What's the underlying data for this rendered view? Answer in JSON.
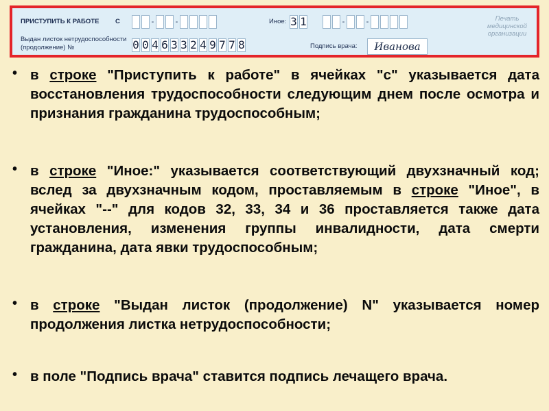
{
  "form": {
    "start_work_label": "ПРИСТУПИТЬ К РАБОТЕ",
    "from_label": "С",
    "other_label": "Иное:",
    "other_code": [
      "3",
      "1"
    ],
    "issued_label_line1": "Выдан листок нетрудоспособности",
    "issued_label_line2": "(продолжение) №",
    "issued_number": [
      "0",
      "0",
      "4",
      "6",
      "3",
      "3",
      "2",
      "4",
      "9",
      "7",
      "7",
      "8"
    ],
    "doctor_signature_label": "Подпись врача:",
    "doctor_signature_value": "Иванова",
    "stamp_line1": "Печать",
    "stamp_line2": "медицинской",
    "stamp_line3": "организации",
    "date_separator": "-"
  },
  "bullets": [
    {
      "marker": "•",
      "p1": "в ",
      "link": "строке",
      "p2": " \"Приступить к работе\" в ячейках \"с\" указывается дата восстановления трудоспособности следующим днем после осмотра и признания гражданина трудоспособным;"
    },
    {
      "marker": "•",
      "p1": "в ",
      "link": "строке",
      "p2": " \"Иное:\" указывается соответствующий двухзначный код; вслед за двухзначным кодом, проставляемым в ",
      "link2": "строке",
      "p3": " \"Иное\", в ячейках \"--\" для кодов 32, 33, 34 и 36 проставляется также дата установления, изменения группы инвалидности, дата смерти гражданина, дата явки трудоспособным;"
    },
    {
      "marker": "•",
      "p1": "в ",
      "link": "строке",
      "p2": " \"Выдан листок (продолжение) N\" указывается номер продолжения листка нетрудоспособности;"
    },
    {
      "marker": "•",
      "p1": "в поле \"Подпись врача\" ставится подпись лечащего врача."
    }
  ]
}
